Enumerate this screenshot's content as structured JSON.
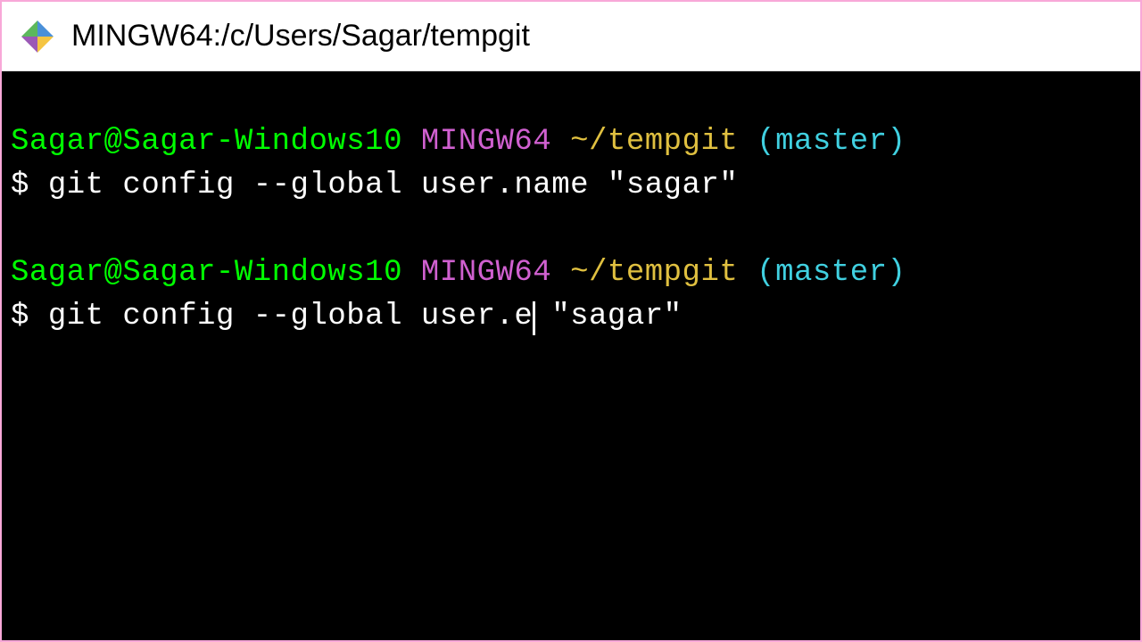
{
  "titlebar": {
    "text": "MINGW64:/c/Users/Sagar/tempgit"
  },
  "terminal": {
    "blocks": [
      {
        "user_host": "Sagar@Sagar-Windows10",
        "env": "MINGW64",
        "path": "~/tempgit",
        "branch": "(master)",
        "dollar": "$",
        "command": "git config --global user.name \"sagar\""
      },
      {
        "user_host": "Sagar@Sagar-Windows10",
        "env": "MINGW64",
        "path": "~/tempgit",
        "branch": "(master)",
        "dollar": "$",
        "command_before_cursor": "git config --global user.e",
        "command_after_cursor": " \"sagar\""
      }
    ]
  }
}
